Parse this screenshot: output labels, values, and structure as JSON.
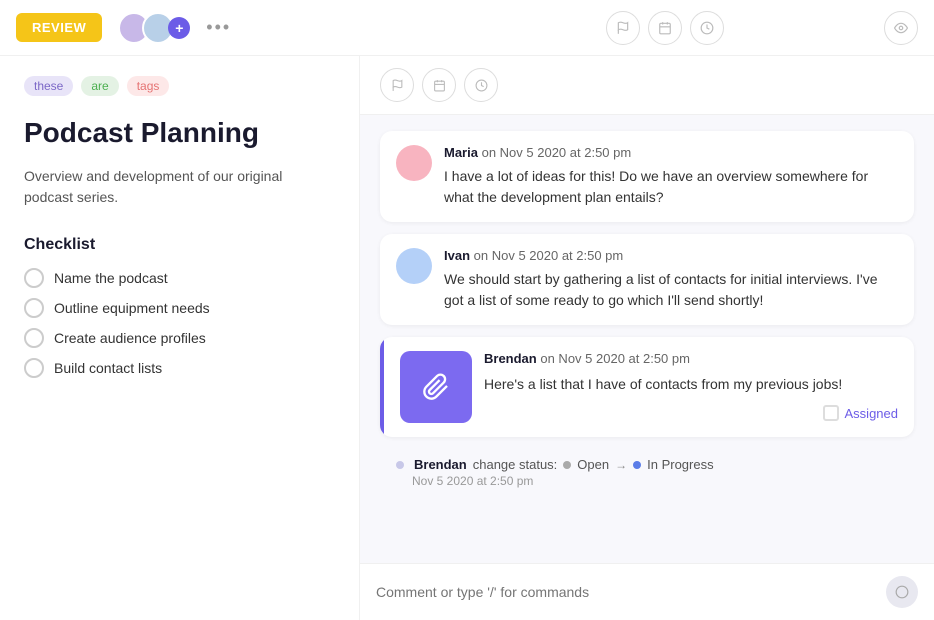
{
  "header": {
    "review_label": "REVIEW",
    "more_label": "•••",
    "avatar_add_label": "+"
  },
  "header_icons": [
    {
      "name": "flag-icon",
      "symbol": "⚑"
    },
    {
      "name": "calendar-icon",
      "symbol": "▭"
    },
    {
      "name": "clock-icon",
      "symbol": "◷"
    },
    {
      "name": "eye-icon",
      "symbol": "◉"
    }
  ],
  "left_panel": {
    "tags": [
      {
        "label": "these",
        "class": "tag-these"
      },
      {
        "label": "are",
        "class": "tag-are"
      },
      {
        "label": "tags",
        "class": "tag-tags"
      }
    ],
    "title": "Podcast Planning",
    "description": "Overview and development of our original podcast series.",
    "checklist_title": "Checklist",
    "checklist_items": [
      "Name the podcast",
      "Outline equipment needs",
      "Create audience profiles",
      "Build contact lists"
    ]
  },
  "comments": [
    {
      "author": "Maria",
      "meta": "on Nov 5 2020 at 2:50 pm",
      "text": "I have a lot of ideas for this! Do we have an overview somewhere for what the development plan entails?"
    },
    {
      "author": "Ivan",
      "meta": "on Nov 5 2020 at 2:50 pm",
      "text": "We should start by gathering a list of contacts for initial interviews. I've got a list of some ready to go which I'll send shortly!"
    }
  ],
  "special_comment": {
    "author": "Brendan",
    "meta": "on Nov 5 2020 at 2:50 pm",
    "text": "Here's a list that I have of contacts from my previous jobs!",
    "assigned_label": "Assigned"
  },
  "status_change": {
    "author": "Brendan",
    "action": "change status:",
    "from": "Open",
    "arrow": "→",
    "to": "In Progress",
    "time": "Nov 5 2020 at 2:50 pm"
  },
  "comment_input": {
    "placeholder": "Comment or type '/' for commands"
  }
}
